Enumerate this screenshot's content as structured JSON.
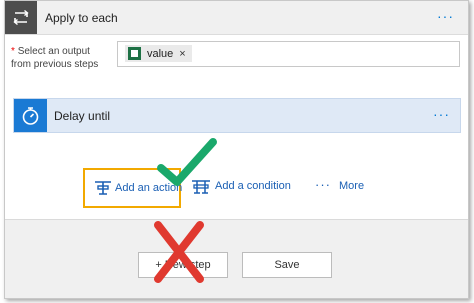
{
  "apply_to_each": {
    "title": "Apply to each",
    "more_label": "···",
    "field_label": "Select an output from previous steps",
    "required_mark": "*",
    "token": {
      "label": "value",
      "remove_label": "×",
      "icon": "excel-icon"
    }
  },
  "delay_card": {
    "title": "Delay until",
    "more_label": "···",
    "icon": "stopwatch-icon"
  },
  "add_options": {
    "add_action": "Add an action",
    "add_condition": "Add a condition",
    "more_dots": "···",
    "more": "More"
  },
  "footer": {
    "new_step": "+ New step",
    "save": "Save"
  },
  "colors": {
    "header_tile": "#4d4d4d",
    "delay_tile": "#1a7ad4",
    "link": "#1a5fb4",
    "highlight_border": "#f2a900",
    "checkmark": "#1aa86b",
    "cross": "#e0392f"
  }
}
